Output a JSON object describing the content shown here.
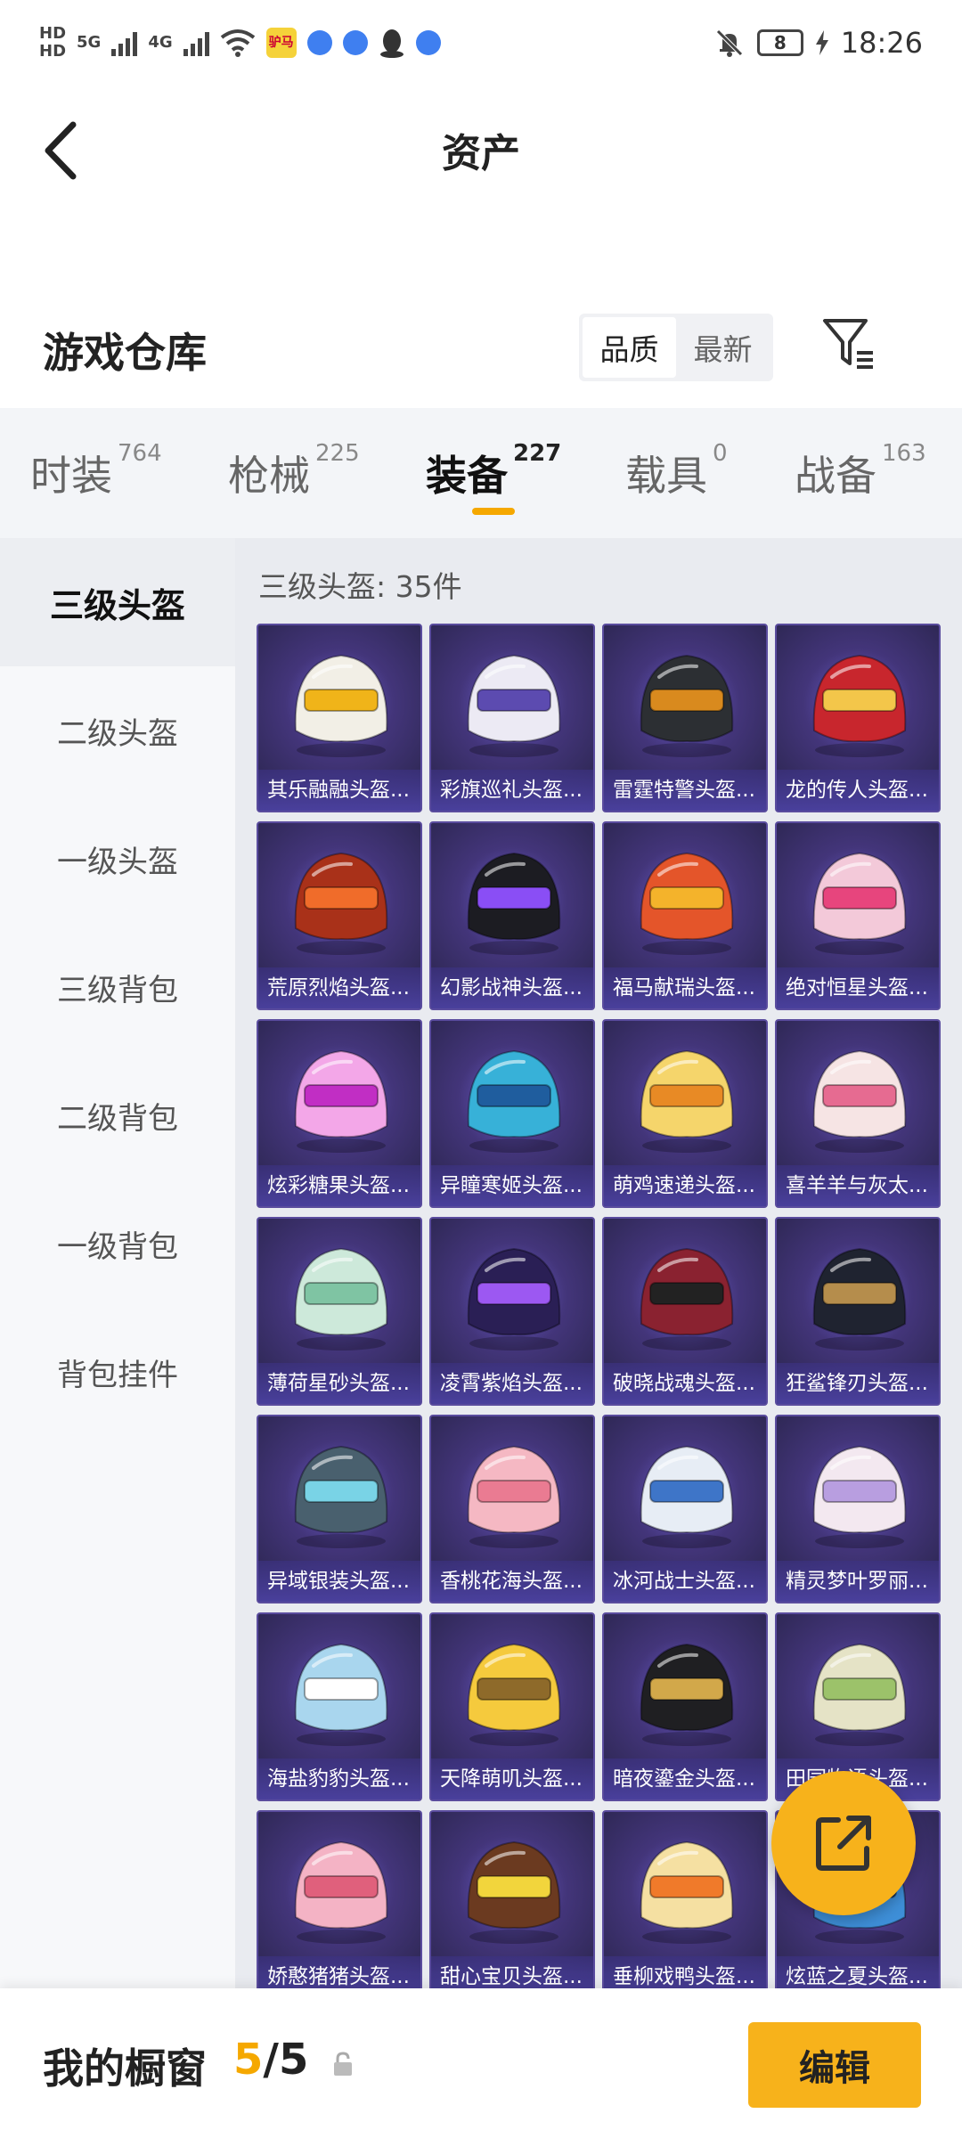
{
  "status_bar": {
    "time": "18:26",
    "battery": "8",
    "network_a": "5G",
    "network_b": "4G",
    "hd_a": "HD",
    "hd_b": "HD",
    "app_badge": "驴马"
  },
  "header": {
    "title": "资产",
    "back_icon": "chevron-left-icon"
  },
  "section": {
    "title": "游戏仓库",
    "sort_options": [
      "品质",
      "最新"
    ],
    "sort_selected": "品质",
    "filter_icon": "filter-icon"
  },
  "tabs": [
    {
      "label": "时装",
      "count": "764"
    },
    {
      "label": "枪械",
      "count": "225"
    },
    {
      "label": "装备",
      "count": "227",
      "active": true
    },
    {
      "label": "载具",
      "count": "0"
    },
    {
      "label": "战备",
      "count": "163"
    }
  ],
  "sidebar": {
    "items": [
      "三级头盔",
      "二级头盔",
      "一级头盔",
      "三级背包",
      "二级背包",
      "一级背包",
      "背包挂件"
    ],
    "active_index": 0
  },
  "content": {
    "header": "三级头盔: 35件",
    "items": [
      {
        "name": "其乐融融头盔...",
        "color": "#f2efe6",
        "accent": "#f0b419"
      },
      {
        "name": "彩旗巡礼头盔...",
        "color": "#eceaf4",
        "accent": "#5c4bb0"
      },
      {
        "name": "雷霆特警头盔...",
        "color": "#2c2f33",
        "accent": "#d98a1e"
      },
      {
        "name": "龙的传人头盔...",
        "color": "#c8262d",
        "accent": "#f3c64a"
      },
      {
        "name": "荒原烈焰头盔...",
        "color": "#a93119",
        "accent": "#f06c2a"
      },
      {
        "name": "幻影战神头盔...",
        "color": "#1c1c22",
        "accent": "#8a4ef5"
      },
      {
        "name": "福马献瑞头盔...",
        "color": "#e4552a",
        "accent": "#f4b32b"
      },
      {
        "name": "绝对恒星头盔...",
        "color": "#f3c9d9",
        "accent": "#e7457d"
      },
      {
        "name": "炫彩糖果头盔...",
        "color": "#f3a7e8",
        "accent": "#c12ec4"
      },
      {
        "name": "异瞳寒姬头盔...",
        "color": "#37b1d8",
        "accent": "#1f5d9e"
      },
      {
        "name": "萌鸡速递头盔...",
        "color": "#f5d56b",
        "accent": "#e88a25"
      },
      {
        "name": "喜羊羊与灰太...",
        "color": "#f6e4e4",
        "accent": "#e66b91"
      },
      {
        "name": "薄荷星砂头盔...",
        "color": "#cde9da",
        "accent": "#7fc4a3"
      },
      {
        "name": "凌霄紫焰头盔...",
        "color": "#2a1f55",
        "accent": "#9c58f2"
      },
      {
        "name": "破晓战魂头盔...",
        "color": "#8a2230",
        "accent": "#222222"
      },
      {
        "name": "狂鲨锋刃头盔...",
        "color": "#1f2330",
        "accent": "#b58d4c"
      },
      {
        "name": "异域银装头盔...",
        "color": "#49606e",
        "accent": "#79d3e6"
      },
      {
        "name": "香桃花海头盔...",
        "color": "#f5b8c3",
        "accent": "#ea7b92"
      },
      {
        "name": "冰河战士头盔...",
        "color": "#e7edf5",
        "accent": "#3e75c8"
      },
      {
        "name": "精灵梦叶罗丽...",
        "color": "#f3e8f0",
        "accent": "#b89ee0"
      },
      {
        "name": "海盐豹豹头盔...",
        "color": "#a9d6ee",
        "accent": "#ffffff"
      },
      {
        "name": "天降萌叽头盔...",
        "color": "#f5ca3d",
        "accent": "#8e6a2a"
      },
      {
        "name": "暗夜鎏金头盔...",
        "color": "#1f1f22",
        "accent": "#d2a84a"
      },
      {
        "name": "田园物语头盔...",
        "color": "#e5e3c6",
        "accent": "#9cc26a"
      },
      {
        "name": "娇憨猪猪头盔...",
        "color": "#f4b3c5",
        "accent": "#e0607c"
      },
      {
        "name": "甜心宝贝头盔...",
        "color": "#6b3a20",
        "accent": "#f2d53c"
      },
      {
        "name": "垂柳戏鸭头盔...",
        "color": "#f5e0a2",
        "accent": "#f07a2a"
      },
      {
        "name": "炫蓝之夏头盔...",
        "color": "#3e8fd8",
        "accent": "#1d3d73"
      }
    ]
  },
  "fab": {
    "icon": "share-icon"
  },
  "bottom_bar": {
    "label": "我的橱窗",
    "count_current": "5",
    "count_sep": "/",
    "count_max": "5",
    "lock_icon": "lock-icon",
    "edit_label": "编辑"
  }
}
